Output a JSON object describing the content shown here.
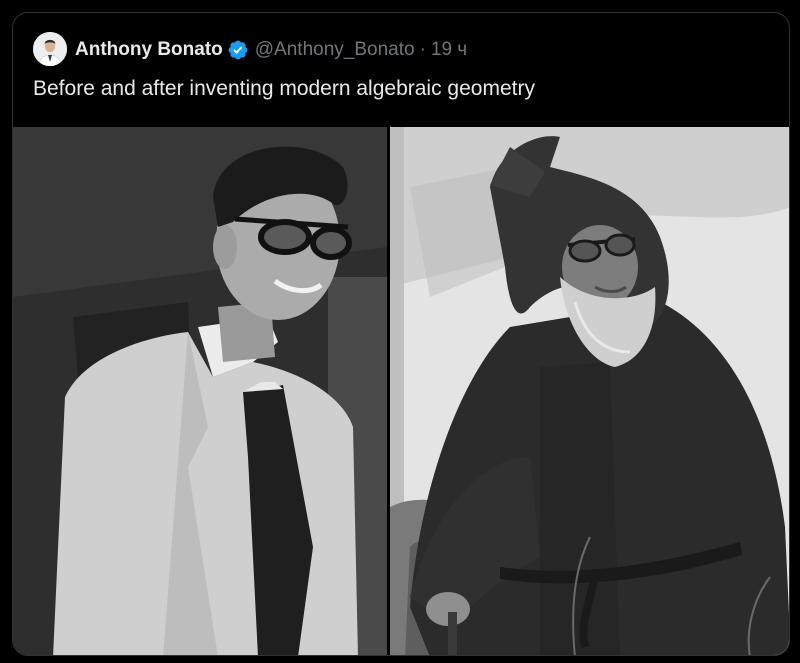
{
  "tweet": {
    "author_name": "Anthony Bonato",
    "author_handle": "@Anthony_Bonato",
    "separator": "·",
    "timestamp": "19 ч",
    "text": "Before and after inventing modern algebraic geometry",
    "verified_icon": "verified-badge-icon",
    "colors": {
      "background": "#000000",
      "border": "#2f3336",
      "primary_text": "#e7e9ea",
      "secondary_text": "#71767b",
      "verified": "#1d9bf0"
    }
  }
}
